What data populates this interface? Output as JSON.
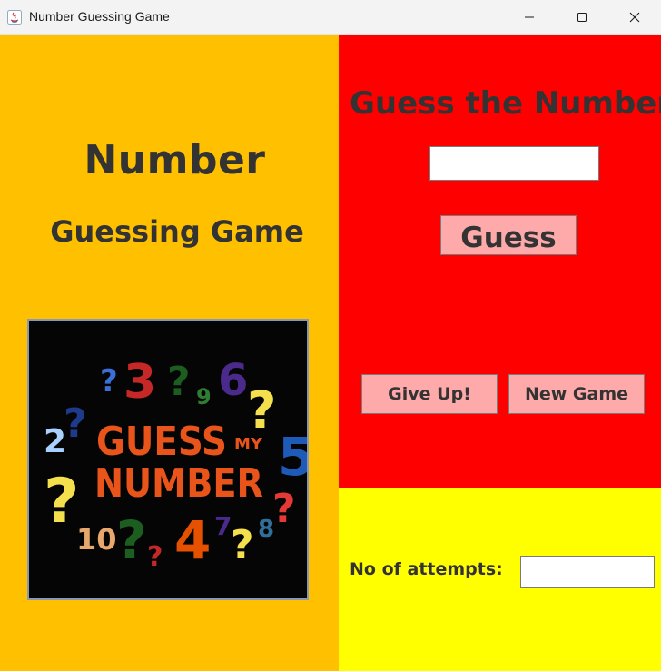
{
  "window": {
    "title": "Number Guessing Game",
    "controls": [
      "minimize-icon",
      "maximize-icon",
      "close-icon"
    ]
  },
  "left_panel": {
    "background": "#ffc000",
    "title_line1": "Number",
    "title_line2": "Guessing Game",
    "logo": {
      "word1": "GUESS",
      "word2": "NUMBER",
      "small_word": "MY",
      "glyphs": [
        "?",
        "3",
        "?",
        "9",
        "6",
        "?",
        "?",
        "2",
        "5",
        "?",
        "?",
        "10",
        "?",
        "?",
        "4",
        "7",
        "?",
        "8"
      ]
    }
  },
  "guess_panel": {
    "background": "#ff0000",
    "heading": "Guess the Number",
    "guess_input_value": "",
    "guess_button": "Guess",
    "give_up_button": "Give Up!",
    "new_game_button": "New Game",
    "button_color": "#ffaaaa"
  },
  "attempts_panel": {
    "background": "#ffff00",
    "label": "No of attempts:",
    "value": ""
  }
}
